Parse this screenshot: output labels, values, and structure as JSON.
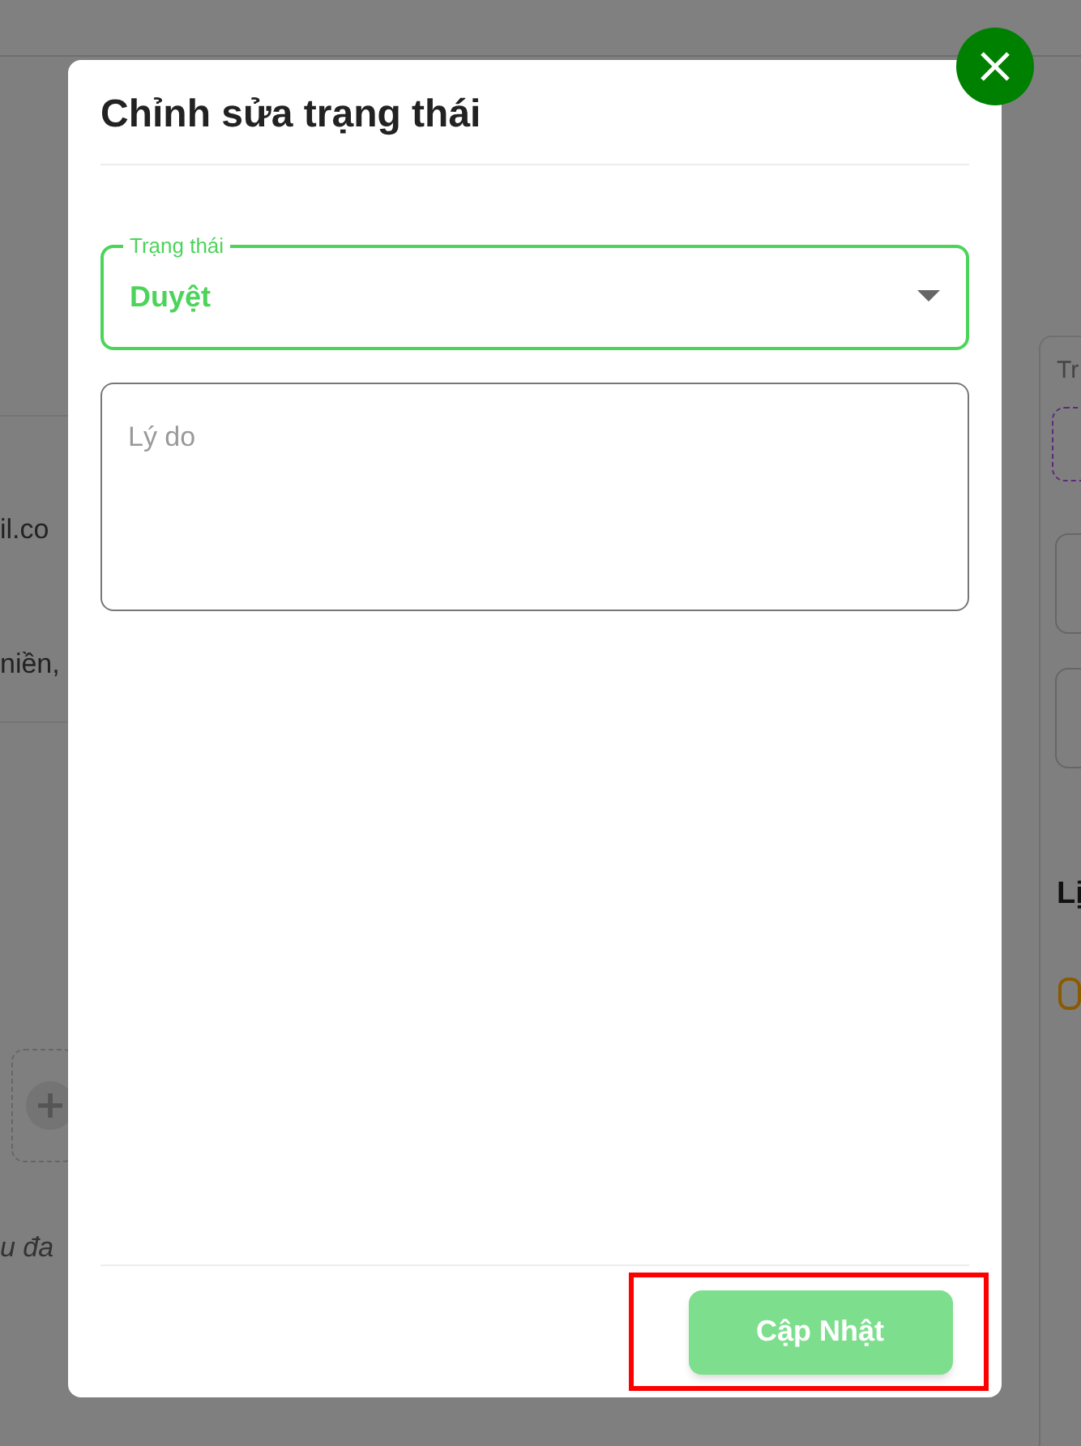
{
  "backdrop": {
    "texts": [
      {
        "kind": "email",
        "text": "il.co"
      },
      {
        "kind": "address",
        "text": "niền,"
      },
      {
        "kind": "label",
        "text": "Tr"
      },
      {
        "kind": "heading",
        "text": "Lị"
      },
      {
        "kind": "note",
        "text": "u đa"
      }
    ]
  },
  "dialog": {
    "title": "Chỉnh sửa trạng thái",
    "status_field": {
      "label": "Trạng thái",
      "value": "Duyệt"
    },
    "reason_field": {
      "placeholder": "Lý do"
    },
    "submit_button": {
      "label": "Cập Nhật",
      "disabled": true,
      "highlighted": true
    }
  }
}
